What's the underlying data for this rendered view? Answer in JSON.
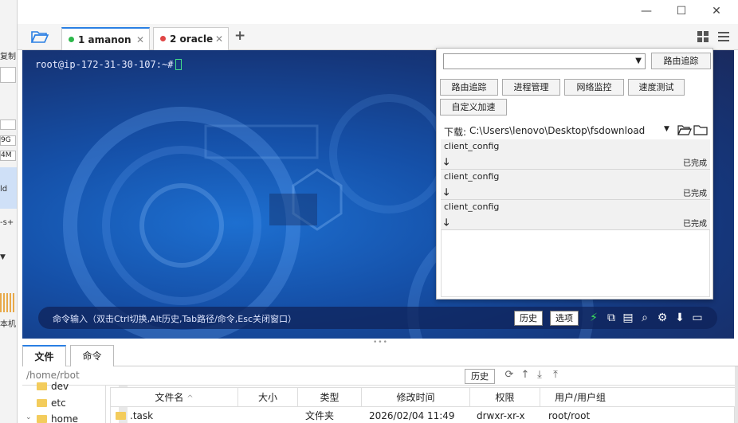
{
  "left_panel": {
    "fragments": [
      "复制",
      "9G",
      "4M",
      "ld",
      "-s+",
      "本机"
    ]
  },
  "window_controls": {
    "minimize": "—",
    "maximize": "☐",
    "close": "✕"
  },
  "tabs": [
    {
      "label": "1 amanon",
      "status_color": "#2db84b"
    },
    {
      "label": "2 oracle",
      "status_color": "#e04646"
    }
  ],
  "tab_close": "✕",
  "tab_add": "+",
  "terminal": {
    "prompt": "root@ip-172-31-30-107:~#",
    "cmd_hint": "命令输入（双击Ctrl切换,Alt历史,Tab路径/命令,Esc关闭窗口）",
    "history_btn": "历史",
    "options_btn": "选项"
  },
  "popup": {
    "trace_input_value": "",
    "trace_button": "路由追踪",
    "tool_buttons": [
      "路由追踪",
      "进程管理",
      "网络监控",
      "速度测试",
      "自定义加速"
    ],
    "download_label": "下载:",
    "download_path": "C:\\Users\\lenovo\\Desktop\\fsdownload",
    "downloads": [
      {
        "name": "client_config",
        "status": "已完成"
      },
      {
        "name": "client_config",
        "status": "已完成"
      },
      {
        "name": "client_config",
        "status": "已完成"
      }
    ]
  },
  "bottom": {
    "tabs": [
      "文件",
      "命令"
    ],
    "path": "/home/rbot",
    "history_btn": "历史",
    "tree": [
      "dev",
      "etc",
      "home"
    ],
    "columns": [
      "文件名",
      "大小",
      "类型",
      "修改时间",
      "权限",
      "用户/用户组"
    ],
    "rows": [
      {
        "name": ".task",
        "size": "",
        "type": "文件夹",
        "mtime": "2026/02/04 11:49",
        "perm": "drwxr-xr-x",
        "owner": "root/root"
      }
    ]
  }
}
